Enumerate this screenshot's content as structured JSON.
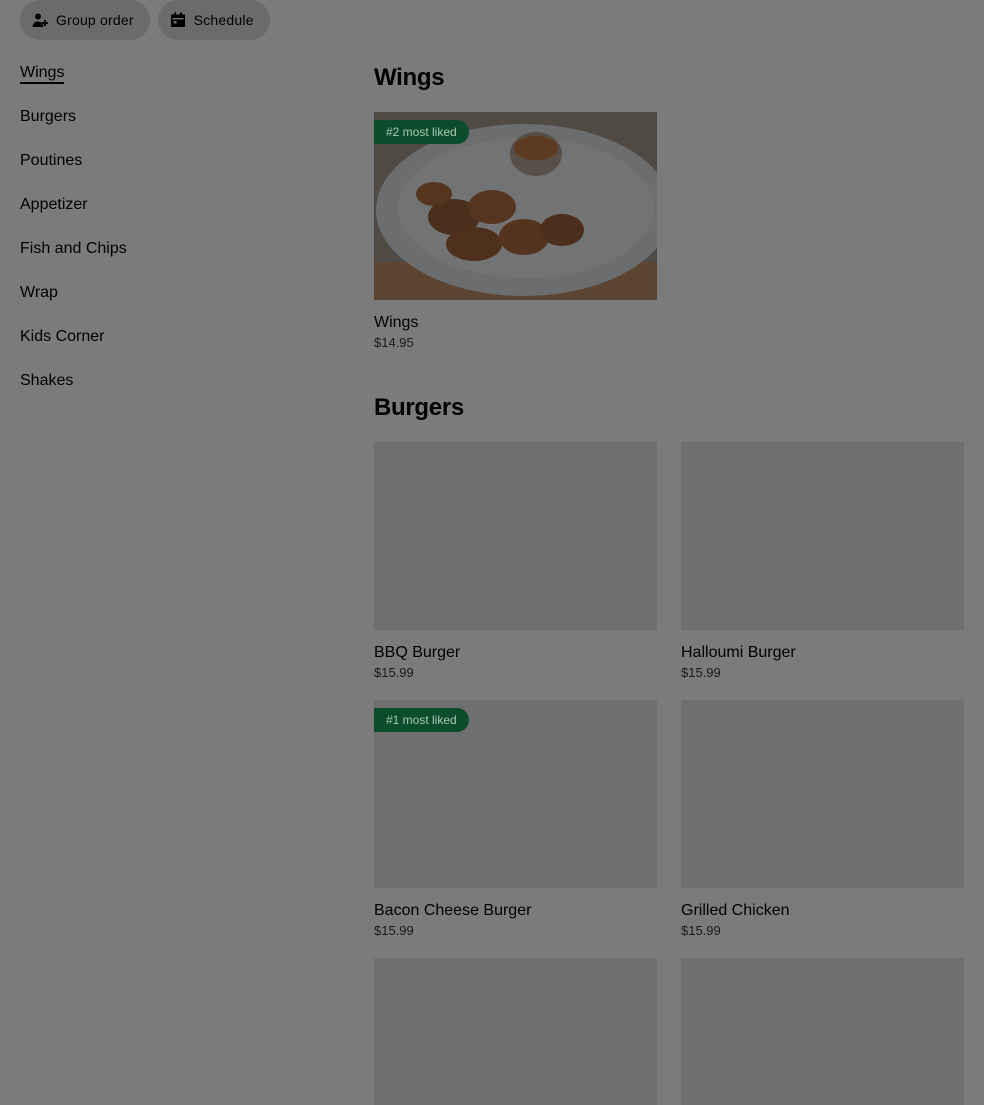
{
  "topbar": {
    "group_order_label": "Group order",
    "schedule_label": "Schedule"
  },
  "sidebar": {
    "items": [
      {
        "label": "Wings",
        "active": true
      },
      {
        "label": "Burgers"
      },
      {
        "label": "Poutines"
      },
      {
        "label": "Appetizer"
      },
      {
        "label": "Fish and Chips"
      },
      {
        "label": "Wrap"
      },
      {
        "label": "Kids Corner"
      },
      {
        "label": "Shakes"
      }
    ]
  },
  "sections": [
    {
      "title": "Wings",
      "items": [
        {
          "name": "Wings",
          "price": "$14.95",
          "badge": "#2 most liked",
          "has_photo": true
        }
      ]
    },
    {
      "title": "Burgers",
      "items": [
        {
          "name": "BBQ Burger",
          "price": "$15.99"
        },
        {
          "name": "Halloumi Burger",
          "price": "$15.99"
        },
        {
          "name": "Bacon Cheese Burger",
          "price": "$15.99",
          "badge": "#1 most liked"
        },
        {
          "name": "Grilled Chicken",
          "price": "$15.99"
        },
        {
          "name": "",
          "price": ""
        },
        {
          "name": "",
          "price": ""
        }
      ]
    }
  ],
  "colors": {
    "overlay_background": "#7b7b7b",
    "badge_background": "#0b4d2a",
    "badge_text": "#a8c9b3"
  }
}
